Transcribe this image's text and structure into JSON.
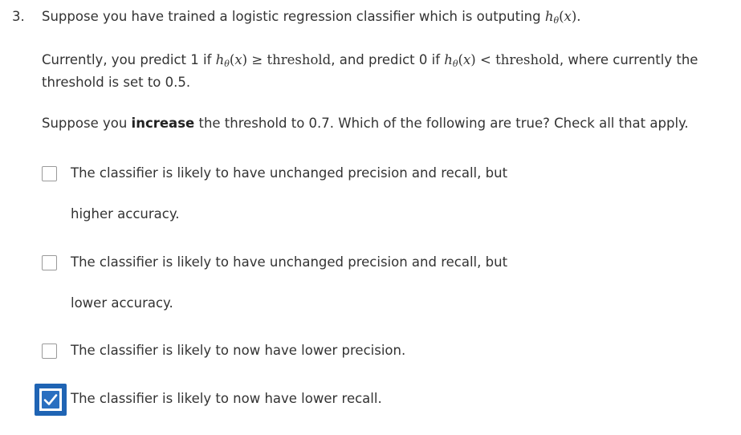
{
  "question": {
    "number": "3.",
    "line1_prefix": "Suppose you have trained a logistic regression classifier which is outputing",
    "line2_a": "Currently, you predict 1 if",
    "line2_b": "threshold",
    "line2_c": ", and predict 0 if",
    "line2_d": "threshold",
    "line2_e": ", where currently the",
    "line3": "threshold is set to 0.5.",
    "line4_a": "Suppose you",
    "line4_bold": "increase",
    "line4_b": "the threshold to 0.7. Which of the following are true? Check all that apply."
  },
  "options": [
    {
      "line1": "The classifier is likely to have unchanged precision and recall, but",
      "line2": "higher accuracy.",
      "checked": false
    },
    {
      "line1": "The classifier is likely to have unchanged precision and recall, but",
      "line2": "lower accuracy.",
      "checked": false
    },
    {
      "line1": "The classifier is likely to now have lower precision.",
      "line2": "",
      "checked": false
    },
    {
      "line1": "The classifier is likely to now have lower recall.",
      "line2": "",
      "checked": true
    }
  ]
}
